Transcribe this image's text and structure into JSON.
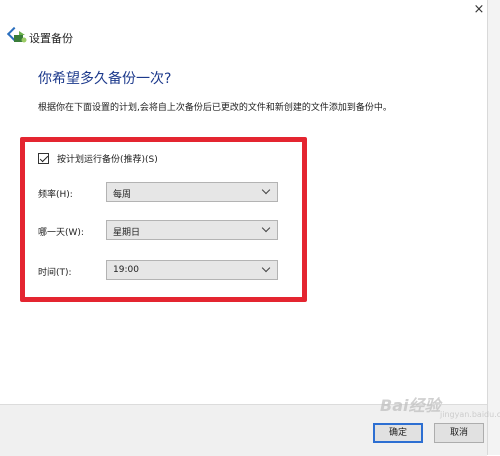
{
  "window": {
    "title": "设置备份",
    "close_glyph": "×"
  },
  "heading": "你希望多久备份一次?",
  "description": "根据你在下面设置的计划,会将自上次备份后已更改的文件和新创建的文件添加到备份中。",
  "schedule": {
    "checkbox_label": "按计划运行备份(推荐)(S)",
    "checked": true,
    "frequency": {
      "label": "频率(H):",
      "value": "每周"
    },
    "day": {
      "label": "哪一天(W):",
      "value": "星期日"
    },
    "time": {
      "label": "时间(T):",
      "value": "19:00"
    }
  },
  "buttons": {
    "ok": "确定",
    "cancel": "取消"
  },
  "watermark": {
    "text": "Bai经验",
    "sub": "jingyan.baidu.com"
  },
  "colors": {
    "highlight_box": "#e42530",
    "heading": "#1d3a8c",
    "ok_border": "#2d6fd2"
  }
}
